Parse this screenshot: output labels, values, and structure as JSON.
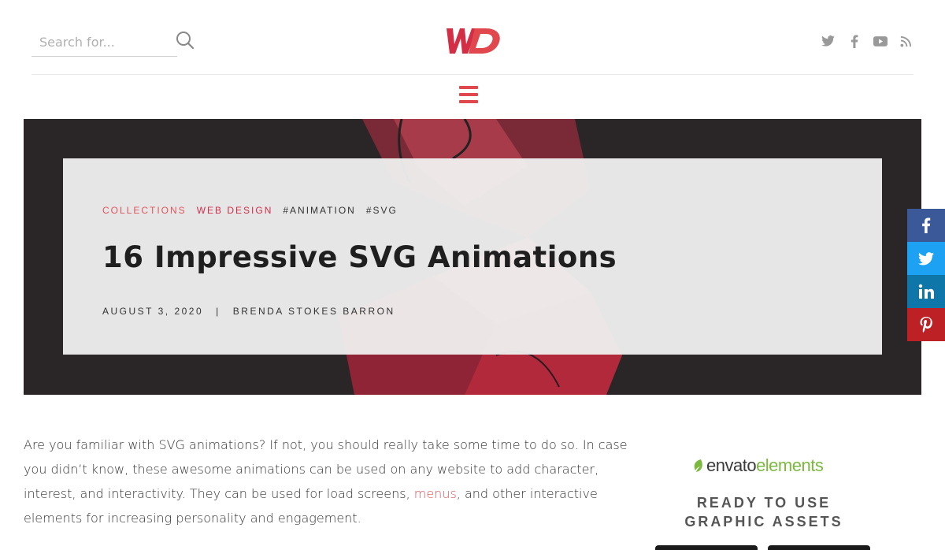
{
  "header": {
    "search_placeholder": "Search for...",
    "logo_text": "WD",
    "brand_color": "#d42e45",
    "socials": [
      "twitter-icon",
      "facebook-icon",
      "youtube-icon",
      "rss-icon"
    ]
  },
  "hero": {
    "tags": [
      {
        "label": "COLLECTIONS"
      },
      {
        "label": "WEB DESIGN"
      },
      {
        "label": "#ANIMATION"
      },
      {
        "label": "#SVG"
      }
    ],
    "title": "16 Impressive SVG Animations",
    "date": "AUGUST 3, 2020",
    "separator": "|",
    "author": "BRENDA STOKES BARRON"
  },
  "share": [
    "facebook-icon",
    "twitter-icon",
    "linkedin-icon",
    "pinterest-icon"
  ],
  "article": {
    "p1_before": "Are you familiar with SVG animations? If not, you should really take some time to do so. In case you didn’t know, these awesome animations can be used on any website to add character, interest, and interactivity. They can be used for load screens, ",
    "p1_link": "menus",
    "p1_after": ", and other interactive elements for increasing personality and engagement."
  },
  "ad": {
    "brand_part1": "envato",
    "brand_part2": "elements",
    "headline_line1": "READY TO USE",
    "headline_line2": "GRAPHIC ASSETS"
  }
}
